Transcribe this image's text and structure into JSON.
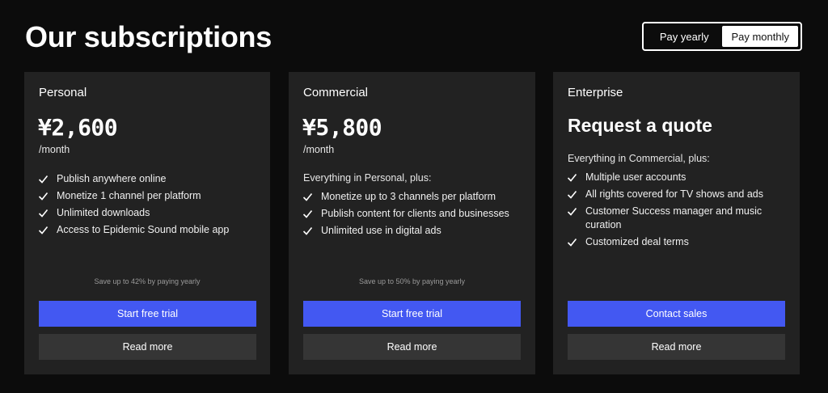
{
  "header": {
    "title": "Our subscriptions",
    "toggle": {
      "yearly_label": "Pay yearly",
      "monthly_label": "Pay monthly",
      "selected": "Pay monthly"
    }
  },
  "plans": [
    {
      "name": "Personal",
      "price": "¥2,600",
      "per": "/month",
      "intro": "",
      "features": [
        "Publish anywhere online",
        "Monetize 1 channel per platform",
        "Unlimited downloads",
        "Access to Epidemic Sound mobile app"
      ],
      "save_note": "Save up to 42% by paying yearly",
      "primary_label": "Start free trial",
      "secondary_label": "Read more"
    },
    {
      "name": "Commercial",
      "price": "¥5,800",
      "per": "/month",
      "intro": "Everything in Personal, plus:",
      "features": [
        "Monetize up to 3 channels per platform",
        "Publish content for clients and businesses",
        "Unlimited use in digital ads"
      ],
      "save_note": "Save up to 50% by paying yearly",
      "primary_label": "Start free trial",
      "secondary_label": "Read more"
    },
    {
      "name": "Enterprise",
      "price": "Request a quote",
      "per": "",
      "intro": "Everything in Commercial, plus:",
      "features": [
        "Multiple user accounts",
        "All rights covered for TV shows and ads",
        "Customer Success manager and music curation",
        "Customized deal terms"
      ],
      "save_note": "",
      "primary_label": "Contact sales",
      "secondary_label": "Read more"
    }
  ],
  "colors": {
    "background": "#0c0c0c",
    "card": "#222222",
    "primary_button": "#4358f2",
    "secondary_button": "#353535"
  },
  "icons": {
    "feature_bullet": "check-icon"
  }
}
